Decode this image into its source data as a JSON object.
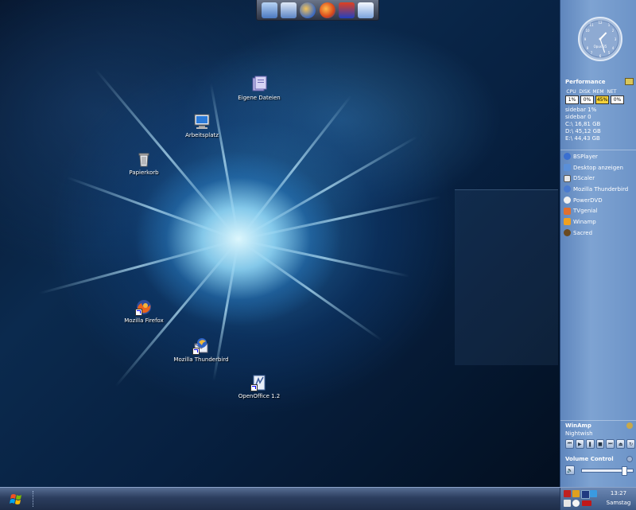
{
  "desktop": {
    "icons": [
      {
        "label": "Eigene Dateien",
        "icon": "documents-folder-icon"
      },
      {
        "label": "Arbeitsplatz",
        "icon": "computer-icon"
      },
      {
        "label": "Papierkorb",
        "icon": "recycle-bin-icon"
      },
      {
        "label": "Mozilla Firefox",
        "icon": "firefox-icon"
      },
      {
        "label": "Mozilla Thunderbird",
        "icon": "thunderbird-icon"
      },
      {
        "label": "OpenOffice 1.2",
        "icon": "openoffice-icon"
      }
    ]
  },
  "quicklaunch": {
    "icons": [
      "show-desktop-icon",
      "openoffice-icon",
      "thunderbird-icon",
      "firefox-icon",
      "tv-app-icon",
      "notes-icon"
    ]
  },
  "sidebar": {
    "clock": {
      "label": "Opus 35",
      "hour": 1,
      "minute": 27
    },
    "performance": {
      "title": "Performance",
      "headers": [
        "CPU",
        "DISK",
        "MEM",
        "NET"
      ],
      "values": [
        "1%",
        "0%",
        "45%",
        "0%"
      ],
      "lines": [
        "sidebar 1%",
        "sidebar 0",
        "C:\\ 16,81 GB",
        "D:\\ 45,12 GB",
        "E:\\ 44,43 GB"
      ]
    },
    "apps": [
      {
        "label": "BSPlayer",
        "color": "#3a6fd0"
      },
      {
        "label": "Desktop anzeigen",
        "color": "#5a8fd8"
      },
      {
        "label": "DScaler",
        "color": "#e8e8e8"
      },
      {
        "label": "Mozilla Thunderbird",
        "color": "#4a7bd0"
      },
      {
        "label": "PowerDVD",
        "color": "#f0f0f0"
      },
      {
        "label": "TVgenial",
        "color": "#e07030"
      },
      {
        "label": "Winamp",
        "color": "#f0a020"
      },
      {
        "label": "Sacred",
        "color": "#6a4a20"
      }
    ],
    "winamp": {
      "title": "WinAmp",
      "track": "Nightwish",
      "controls": [
        "prev",
        "play",
        "pause",
        "stop",
        "next",
        "eject",
        "repeat"
      ]
    },
    "volume": {
      "title": "Volume Control",
      "level": 0.85
    }
  },
  "taskbar": {
    "time": "13:27",
    "day": "Samstag",
    "tray_icons": [
      "media-icon",
      "network-icon",
      "display-icon",
      "messenger-icon",
      "shield-icon",
      "ati-icon",
      "speaker-icon"
    ]
  },
  "colors": {
    "sidebar": "#7ea3d2",
    "taskbar": "#2b3d5e",
    "accent": "#8fdcff"
  }
}
